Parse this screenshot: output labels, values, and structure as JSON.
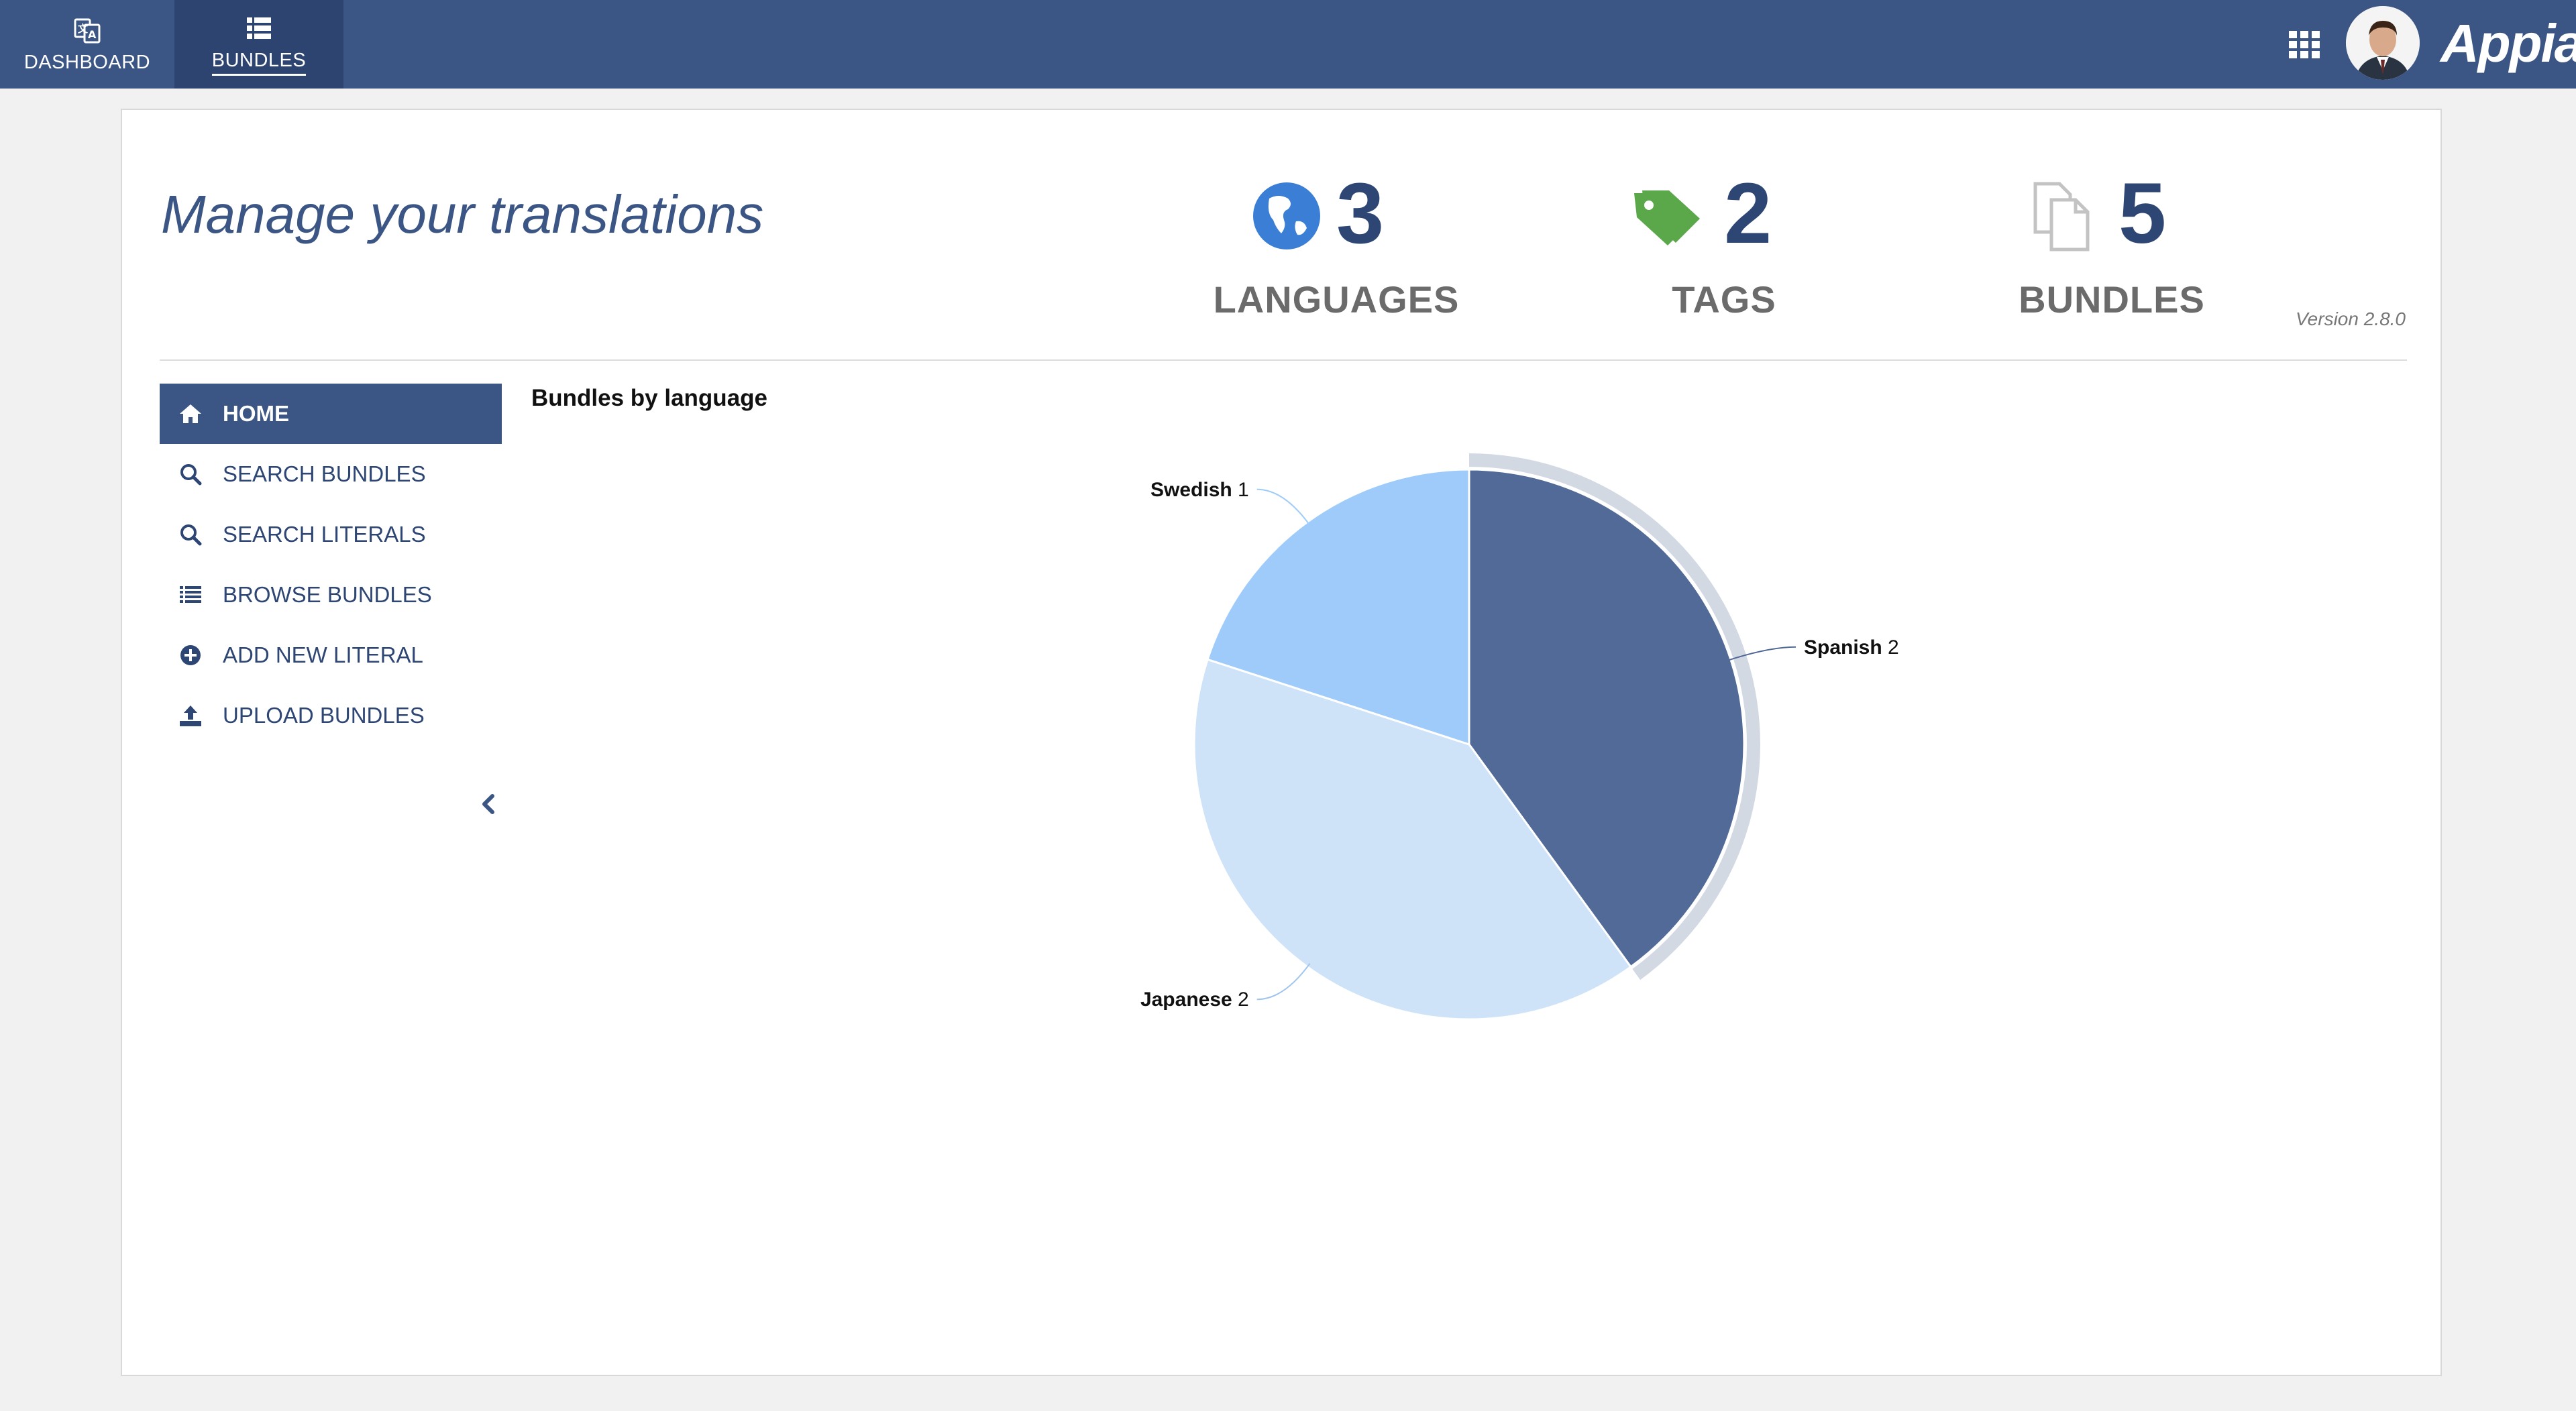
{
  "nav": {
    "tabs": [
      {
        "label": "DASHBOARD",
        "icon": "translate-icon"
      },
      {
        "label": "BUNDLES",
        "icon": "list-icon",
        "active": true
      }
    ],
    "apps_icon": "grid-icon",
    "brand": "Appian"
  },
  "header": {
    "title": "Manage your translations",
    "version": "Version 2.8.0",
    "stats": [
      {
        "value": "3",
        "label": "LANGUAGES",
        "icon": "globe-icon",
        "color": "#3a7fd5"
      },
      {
        "value": "2",
        "label": "TAGS",
        "icon": "tags-icon",
        "color": "#5aa84a"
      },
      {
        "value": "5",
        "label": "BUNDLES",
        "icon": "files-icon",
        "color": "#bdbdbd"
      }
    ]
  },
  "sidebar": {
    "items": [
      {
        "label": "HOME",
        "icon": "home-icon",
        "active": true
      },
      {
        "label": "SEARCH BUNDLES",
        "icon": "search-icon"
      },
      {
        "label": "SEARCH LITERALS",
        "icon": "search-icon"
      },
      {
        "label": "BROWSE BUNDLES",
        "icon": "list-icon"
      },
      {
        "label": "ADD NEW LITERAL",
        "icon": "plus-circle-icon"
      },
      {
        "label": "UPLOAD BUNDLES",
        "icon": "upload-icon"
      }
    ],
    "collapse_icon": "chevron-left-icon"
  },
  "chart": {
    "title": "Bundles by language"
  },
  "chart_data": {
    "type": "pie",
    "title": "Bundles by language",
    "categories": [
      "Spanish",
      "Japanese",
      "Swedish"
    ],
    "values": [
      2,
      2,
      1
    ],
    "colors": [
      "#526a97",
      "#cfe3f8",
      "#9ecbfa"
    ],
    "highlighted": "Spanish",
    "data_labels": true
  },
  "colors": {
    "nav_bg": "#3b5584",
    "nav_active": "#2d4470",
    "accent": "#3b5584"
  }
}
